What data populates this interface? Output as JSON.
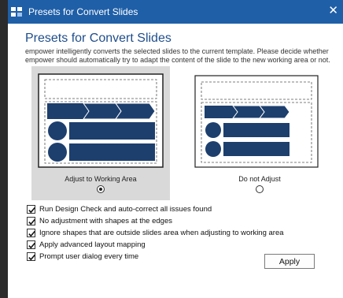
{
  "window": {
    "title": "Presets for Convert Slides",
    "close_symbol": "✕",
    "app_icon": "app-logo-icon"
  },
  "dialog": {
    "heading": "Presets for Convert Slides",
    "description": "empower intelligently converts the selected slides to the current template. Please decide whether empower should automatically try to adapt the content of the slide to the new working area or not.",
    "options": [
      {
        "label": "Adjust to Working Area",
        "selected": true
      },
      {
        "label": "Do not Adjust",
        "selected": false
      }
    ],
    "checkboxes": [
      {
        "label": "Run Design Check and auto-correct all issues found",
        "checked": true
      },
      {
        "label": "No adjustment with shapes at the edges",
        "checked": true
      },
      {
        "label": "Ignore shapes that are outside slides area when adjusting to working area",
        "checked": true
      },
      {
        "label": "Apply advanced layout mapping",
        "checked": true
      },
      {
        "label": "Prompt user dialog every time",
        "checked": true
      }
    ],
    "apply_label": "Apply"
  },
  "colors": {
    "titlebar": "#1f5fa8",
    "heading": "#1f4e8c",
    "shape_fill": "#1d3f6e",
    "selected_bg": "#d9d9d9"
  }
}
